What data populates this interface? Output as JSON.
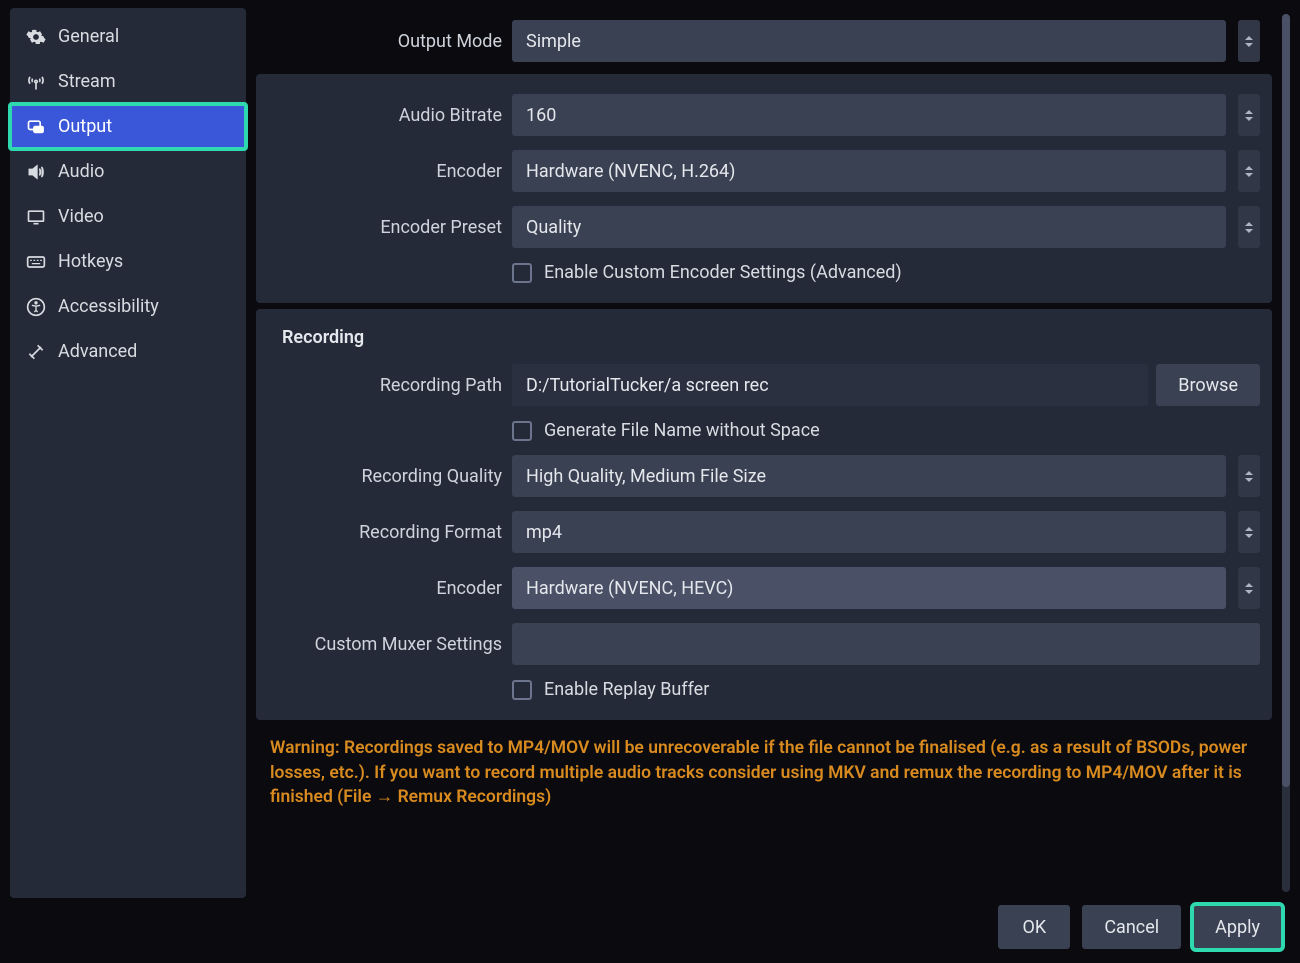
{
  "sidebar": {
    "items": [
      {
        "icon": "gear-icon",
        "label": "General"
      },
      {
        "icon": "antenna-icon",
        "label": "Stream"
      },
      {
        "icon": "monitor-icon",
        "label": "Output",
        "active": true,
        "highlighted": true
      },
      {
        "icon": "speaker-icon",
        "label": "Audio"
      },
      {
        "icon": "display-icon",
        "label": "Video"
      },
      {
        "icon": "keyboard-icon",
        "label": "Hotkeys"
      },
      {
        "icon": "accessibility-icon",
        "label": "Accessibility"
      },
      {
        "icon": "tools-icon",
        "label": "Advanced"
      }
    ]
  },
  "settings": {
    "output_mode": {
      "label": "Output Mode",
      "value": "Simple"
    },
    "audio_bitrate": {
      "label": "Audio Bitrate",
      "value": "160"
    },
    "streaming_encoder": {
      "label": "Encoder",
      "value": "Hardware (NVENC, H.264)"
    },
    "encoder_preset": {
      "label": "Encoder Preset",
      "value": "Quality"
    },
    "custom_encoder_checkbox": {
      "label": "Enable Custom Encoder Settings (Advanced)",
      "checked": false
    },
    "recording": {
      "section_title": "Recording",
      "path": {
        "label": "Recording Path",
        "value": "D:/TutorialTucker/a screen rec",
        "browse": "Browse"
      },
      "no_space_checkbox": {
        "label": "Generate File Name without Space",
        "checked": false
      },
      "quality": {
        "label": "Recording Quality",
        "value": "High Quality, Medium File Size"
      },
      "format": {
        "label": "Recording Format",
        "value": "mp4"
      },
      "encoder": {
        "label": "Encoder",
        "value": "Hardware (NVENC, HEVC)"
      },
      "muxer": {
        "label": "Custom Muxer Settings",
        "value": ""
      },
      "replay_buffer_checkbox": {
        "label": "Enable Replay Buffer",
        "checked": false
      }
    },
    "warning": "Warning: Recordings saved to MP4/MOV will be unrecoverable if the file cannot be finalised (e.g. as a result of BSODs, power losses, etc.). If you want to record multiple audio tracks consider using MKV and remux the recording to MP4/MOV after it is finished (File → Remux Recordings)"
  },
  "footer": {
    "ok": "OK",
    "cancel": "Cancel",
    "apply": "Apply"
  }
}
